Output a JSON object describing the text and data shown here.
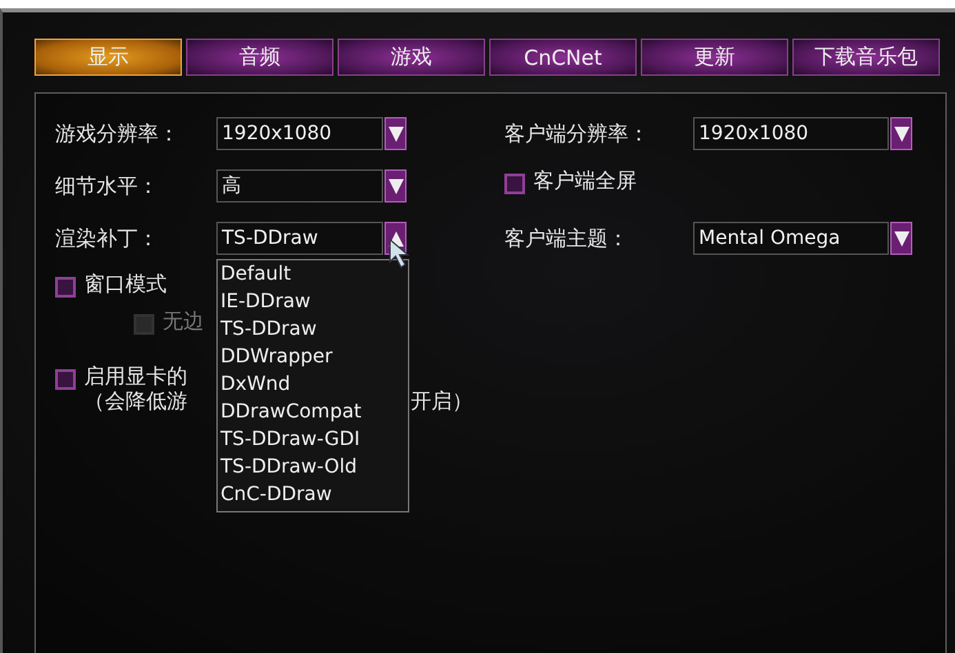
{
  "tabs": [
    {
      "label": "显示",
      "selected": true
    },
    {
      "label": "音频",
      "selected": false
    },
    {
      "label": "游戏",
      "selected": false
    },
    {
      "label": "CnCNet",
      "selected": false
    },
    {
      "label": "更新",
      "selected": false
    },
    {
      "label": "下载音乐包",
      "selected": false
    }
  ],
  "settings_left": [
    {
      "kind": "select",
      "label": "游戏分辨率：",
      "value": "1920x1080",
      "open": false
    },
    {
      "kind": "select",
      "label": "细节水平：",
      "value": "高",
      "open": false
    },
    {
      "kind": "select",
      "label": "渲染补丁：",
      "value": "TS-DDraw",
      "open": true,
      "options": [
        "Default",
        "IE-DDraw",
        "TS-DDraw",
        "DDWrapper",
        "DxWnd",
        "DDrawCompat",
        "TS-DDraw-GDI",
        "TS-DDraw-Old",
        "CnC-DDraw"
      ]
    },
    {
      "kind": "checkbox",
      "label": "窗口模式",
      "checked": false,
      "disabled": false,
      "children": [
        {
          "kind": "checkbox",
          "label": "无边",
          "checked": false,
          "disabled": true
        }
      ]
    },
    {
      "kind": "checkbox",
      "label": "启用显卡的",
      "note_start": "（会降低游",
      "note_end": "开启）",
      "checked": false,
      "disabled": false
    }
  ],
  "settings_right": [
    {
      "kind": "select",
      "label": "客户端分辨率：",
      "value": "1920x1080",
      "open": false
    },
    {
      "kind": "checkbox",
      "label": "客户端全屏",
      "checked": false,
      "disabled": false
    },
    {
      "kind": "select",
      "label": "客户端主题：",
      "value": "Mental Omega",
      "open": false
    }
  ]
}
